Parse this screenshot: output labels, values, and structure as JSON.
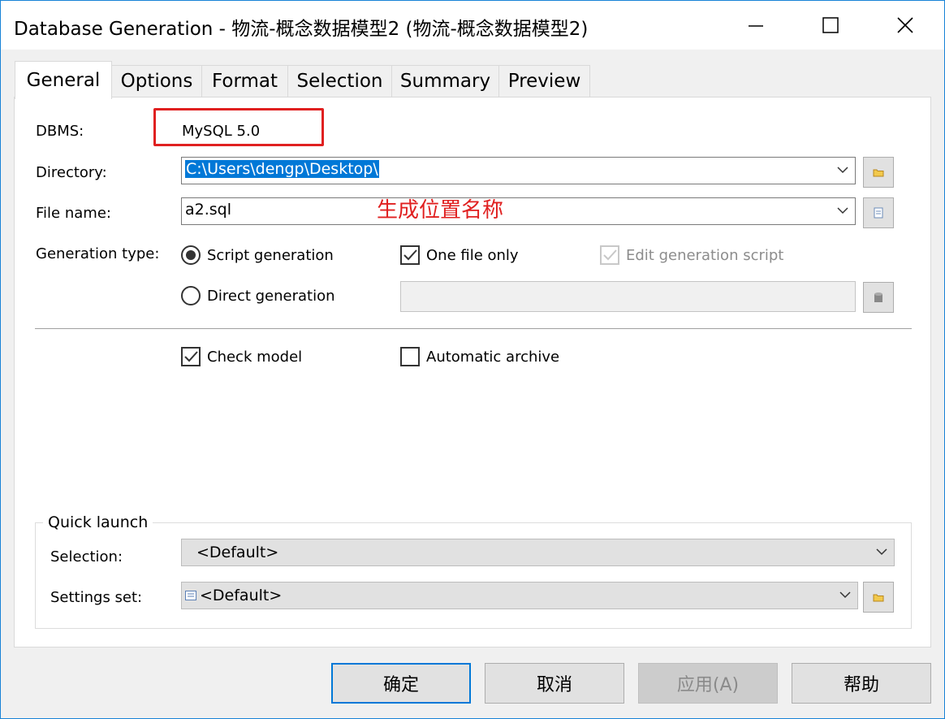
{
  "window": {
    "title": "Database Generation - 物流-概念数据模型2 (物流-概念数据模型2)"
  },
  "tabs": [
    {
      "label": "General",
      "active": true
    },
    {
      "label": "Options"
    },
    {
      "label": "Format"
    },
    {
      "label": "Selection"
    },
    {
      "label": "Summary"
    },
    {
      "label": "Preview"
    }
  ],
  "general": {
    "dbms_label": "DBMS:",
    "dbms_value": "MySQL 5.0",
    "directory_label": "Directory:",
    "directory_value": "C:\\Users\\dengp\\Desktop\\",
    "filename_label": "File name:",
    "filename_value": "a2.sql",
    "generation_type_label": "Generation type:",
    "script_generation": "Script generation",
    "direct_generation": "Direct generation",
    "one_file_only": "One file only",
    "edit_generation_script": "Edit generation script",
    "direct_generation_value": "",
    "check_model": "Check model",
    "automatic_archive": "Automatic archive"
  },
  "annotation": {
    "text": "生成位置名称",
    "color": "#e02020"
  },
  "quick_launch": {
    "title": "Quick launch",
    "selection_label": "Selection:",
    "selection_value": "<Default>",
    "settings_label": "Settings set:",
    "settings_value": "<Default>"
  },
  "buttons": {
    "ok": "确定",
    "cancel": "取消",
    "apply": "应用(A)",
    "help": "帮助"
  },
  "colors": {
    "accent": "#0078d7",
    "annotation": "#e02020",
    "window_border": "#1883d7"
  }
}
